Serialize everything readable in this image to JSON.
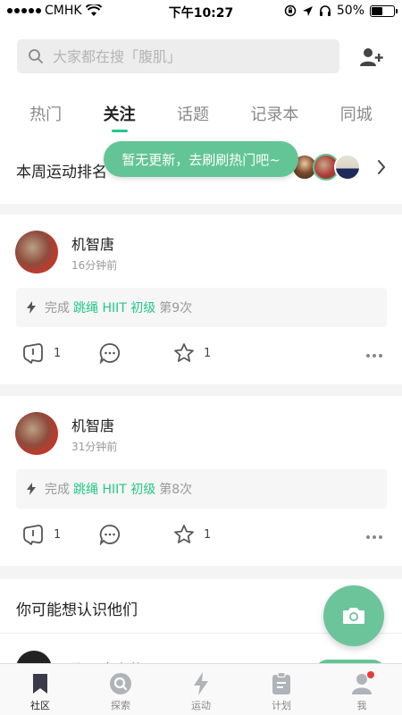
{
  "status_bar": {
    "carrier": "CMHK",
    "time": "下午10:27",
    "battery_percent": "50%",
    "battery_level": 0.5
  },
  "header": {
    "search_placeholder": "大家都在搜「腹肌」",
    "add_user_icon": "add-user-icon",
    "tabs": [
      {
        "label": "热门",
        "active": false
      },
      {
        "label": "关注",
        "active": true
      },
      {
        "label": "话题",
        "active": false
      },
      {
        "label": "记录本",
        "active": false
      },
      {
        "label": "同城",
        "active": false
      }
    ]
  },
  "weekly_ranking": {
    "title": "本周运动排名",
    "toast": "暂无更新，去刷刷热门吧~"
  },
  "feed": [
    {
      "name": "机智唐",
      "time": "16分钟前",
      "activity_prefix": "完成",
      "activity_course": "跳绳 HIIT 初级",
      "activity_count": "第9次",
      "likes": "1",
      "favorites": "1"
    },
    {
      "name": "机智唐",
      "time": "31分钟前",
      "activity_prefix": "完成",
      "activity_course": "跳绳 HIIT 初级",
      "activity_count": "第8次",
      "likes": "1",
      "favorites": "1"
    }
  ],
  "suggestions": {
    "title": "你可能想认识他们",
    "partial_name": "狮子座大艺"
  },
  "tab_bar": [
    {
      "label": "社区",
      "icon": "bookmark-icon",
      "active": true
    },
    {
      "label": "探索",
      "icon": "explore-icon",
      "active": false
    },
    {
      "label": "运动",
      "icon": "lightning-icon",
      "active": false
    },
    {
      "label": "计划",
      "icon": "plan-icon",
      "active": false
    },
    {
      "label": "我",
      "icon": "profile-icon",
      "active": false,
      "badge": true
    }
  ],
  "colors": {
    "accent": "#24c789",
    "toast_bg": "#63c595",
    "fab_bg": "#6cc49a",
    "badge": "#e63b3b"
  }
}
